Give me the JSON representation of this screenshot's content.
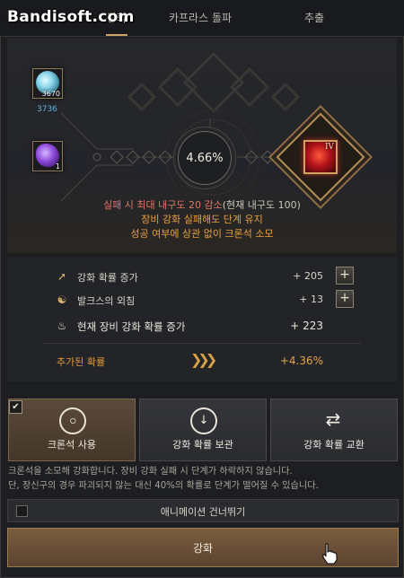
{
  "watermark": "Bandisoft.com",
  "tabs": [
    {
      "label": "강화",
      "active": true
    },
    {
      "label": "카프라스 돌파",
      "active": false
    },
    {
      "label": "추출",
      "active": false
    }
  ],
  "materials": [
    {
      "icon": "crystal-ore-icon",
      "count": "3670",
      "owned": "3736"
    },
    {
      "icon": "purple-gem-icon",
      "count": "1"
    }
  ],
  "success_rate": "4.66%",
  "equipment": {
    "icon": "red-crystal-equipment-icon",
    "level": "IV"
  },
  "warnings": {
    "line1_main": "실패 시 최대 내구도 20 감소",
    "line1_suffix": "(현재 내구도 100)",
    "line2": "장비 강화 실패해도 단계 유지",
    "line3": "성공 여부에 상관 없이 크론석 소모"
  },
  "stats": {
    "rows": [
      {
        "icon": "arrow-up-icon",
        "label": "강화 확률 증가",
        "value": "+ 205"
      },
      {
        "icon": "yin-yang-icon",
        "label": "발크스의 외침",
        "value": "+ 13"
      }
    ],
    "total": {
      "icon": "flame-icon",
      "label": "현재 장비 강화 확률 증가",
      "value": "+ 223"
    },
    "added": {
      "label": "추가된 확률",
      "value": "+4.36%"
    }
  },
  "actions": [
    {
      "label": "크론석 사용",
      "icon": "cron-stone-icon",
      "selected": true
    },
    {
      "label": "강화 확률 보관",
      "icon": "download-icon",
      "selected": false
    },
    {
      "label": "강화 확률 교환",
      "icon": "exchange-icon",
      "selected": false
    }
  ],
  "description": {
    "line1": "크론석을 소모해 강화합니다. 장비 강화 실패 시 단계가 하락하지 않습니다.",
    "line2": "단, 장신구의 경우 파괴되지 않는 대신 40%의 확률로 단계가 떨어질 수 있습니다."
  },
  "skip_animation": {
    "label": "애니메이션 건너뛰기",
    "checked": false
  },
  "enhance_button": "강화",
  "colors": {
    "accent_gold": "#caa66a",
    "warn_red": "#e07666",
    "warn_orange": "#e9a03c",
    "stat_blue": "#5db5e8"
  }
}
